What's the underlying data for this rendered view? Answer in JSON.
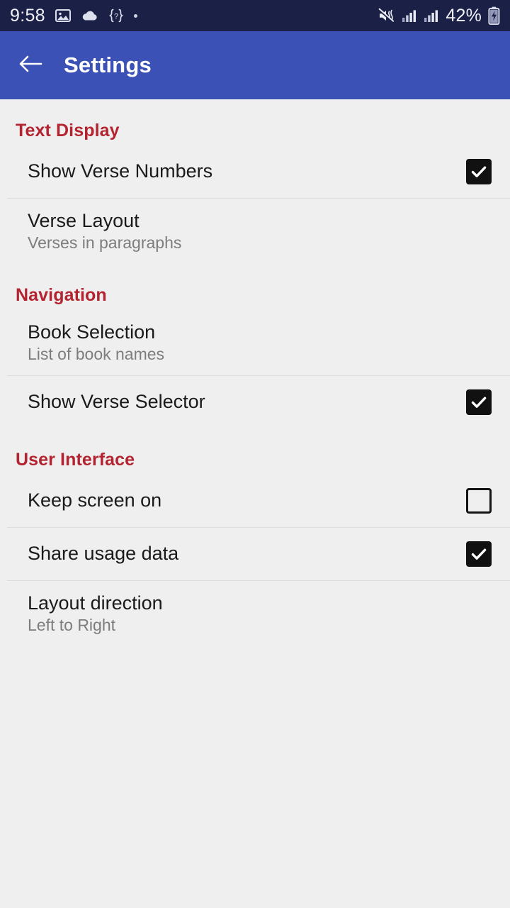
{
  "status_bar": {
    "time": "9:58",
    "battery_percent": "42%",
    "icons": [
      "image-icon",
      "cloud-icon",
      "braces-question-icon",
      "dot-icon"
    ],
    "right_icons": [
      "vibrate-mute-icon",
      "signal-bars-icon",
      "signal-bars-icon",
      "battery-charging-icon"
    ],
    "background": "#1b2047"
  },
  "app_bar": {
    "title": "Settings",
    "back_icon": "arrow-left-icon",
    "background": "#3b51b5"
  },
  "theme": {
    "page_background": "#efefef",
    "section_header_color": "#b32430",
    "title_color": "#1a1a1a",
    "subtitle_color": "#7d7d7d",
    "divider_color": "#dcdcdc",
    "checkbox_color": "#111111"
  },
  "sections": [
    {
      "header": "Text Display",
      "items": [
        {
          "title": "Show Verse Numbers",
          "subtitle": "",
          "control": "checkbox",
          "checked": true
        },
        {
          "title": "Verse Layout",
          "subtitle": "Verses in paragraphs",
          "control": "none",
          "checked": false
        }
      ]
    },
    {
      "header": "Navigation",
      "items": [
        {
          "title": "Book Selection",
          "subtitle": "List of book names",
          "control": "none",
          "checked": false
        },
        {
          "title": "Show Verse Selector",
          "subtitle": "",
          "control": "checkbox",
          "checked": true
        }
      ]
    },
    {
      "header": "User Interface",
      "items": [
        {
          "title": "Keep screen on",
          "subtitle": "",
          "control": "checkbox",
          "checked": false
        },
        {
          "title": "Share usage data",
          "subtitle": "",
          "control": "checkbox",
          "checked": true
        },
        {
          "title": "Layout direction",
          "subtitle": "Left to Right",
          "control": "none",
          "checked": false
        }
      ]
    }
  ]
}
